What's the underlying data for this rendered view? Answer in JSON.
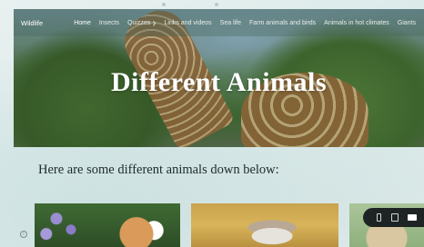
{
  "navbar": {
    "brand": "Wildlife",
    "items": [
      {
        "label": "Home",
        "active": true
      },
      {
        "label": "Insects"
      },
      {
        "label": "Quizzes"
      },
      {
        "label": "Links and videos"
      },
      {
        "label": "Sea life"
      },
      {
        "label": "Farm animals and birds"
      },
      {
        "label": "Animals in hot climates"
      },
      {
        "label": "Giants"
      }
    ],
    "quizzes_chevron": "❯"
  },
  "hero": {
    "title": "Different Animals"
  },
  "content": {
    "subtitle": "Here are some different animals down below:"
  },
  "cards": [
    {
      "name": "dog-image"
    },
    {
      "name": "cat-image"
    },
    {
      "name": "animal-image"
    }
  ],
  "device_toolbar": {
    "icons": [
      "mobile-icon",
      "tablet-icon",
      "desktop-icon"
    ],
    "selected": "desktop-icon"
  },
  "info_icon_glyph": "i",
  "colors": {
    "toolbar_bg": "#1d2423",
    "page_bg": "#e3eeed",
    "subtitle": "#1f2a2a"
  }
}
